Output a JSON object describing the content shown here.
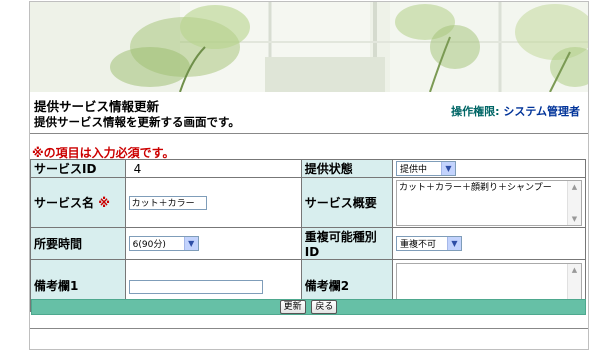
{
  "header": {
    "title": "提供サービス情報更新",
    "description": "提供サービス情報を更新する画面です。",
    "permission_label": "操作権限:",
    "permission_value": "システム管理者"
  },
  "required_note": "※の項目は入力必須です。",
  "form": {
    "service_id": {
      "label": "サービスID",
      "value": "4"
    },
    "status": {
      "label": "提供状態",
      "selected": "提供中"
    },
    "service_name": {
      "label": "サービス名",
      "required_mark": "※",
      "value": "カット＋カラー"
    },
    "summary": {
      "label": "サービス概要",
      "value": "カット＋カラー＋顔剃り＋シャンプー"
    },
    "duration": {
      "label": "所要時間",
      "selected": "6(90分)"
    },
    "overlap": {
      "label": "重複可能種別ID",
      "selected": "重複不可"
    },
    "note1": {
      "label": "備考欄1",
      "value": ""
    },
    "note2": {
      "label": "備考欄2",
      "value": ""
    }
  },
  "buttons": {
    "update": "更新",
    "back": "戻る"
  },
  "icons": {
    "dropdown": "chevron-down-icon",
    "scroll_up": "scroll-up-icon",
    "scroll_down": "scroll-down-icon"
  },
  "colors": {
    "label_bg": "#d8eeee",
    "button_bar": "#66c0a6",
    "required": "#cc0000"
  }
}
